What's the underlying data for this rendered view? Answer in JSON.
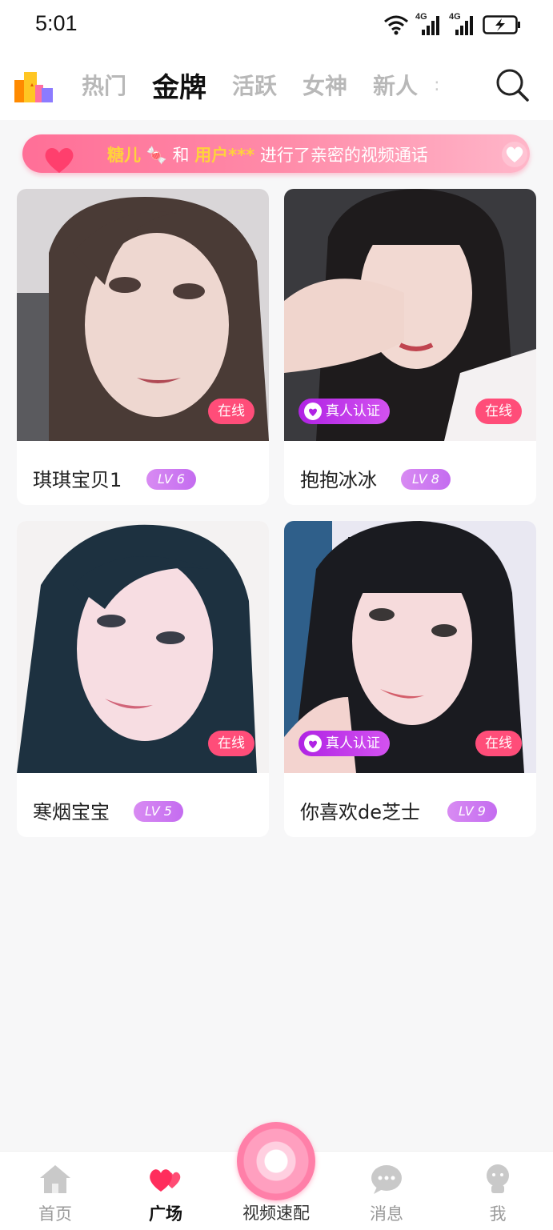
{
  "status_bar": {
    "time": "5:01",
    "signal1": "4G",
    "signal2": "4G"
  },
  "top_nav": {
    "tabs": [
      {
        "label": "热门"
      },
      {
        "label": "金牌"
      },
      {
        "label": "活跃"
      },
      {
        "label": "女神"
      },
      {
        "label": "新人"
      }
    ],
    "more": ":"
  },
  "banner": {
    "user1": "糖儿",
    "connector": "和",
    "user2": "用户***",
    "message": "进行了亲密的视频通话"
  },
  "cards": [
    {
      "name": "琪琪宝贝1",
      "level": "LV 6",
      "online": "在线",
      "verified": ""
    },
    {
      "name": "抱抱冰冰",
      "level": "LV 8",
      "online": "在线",
      "verified": "真人认证"
    },
    {
      "name": "寒烟宝宝",
      "level": "LV 5",
      "online": "在线",
      "verified": ""
    },
    {
      "name": "你喜欢de芝士",
      "level": "LV 9",
      "online": "在线",
      "verified": "真人认证"
    }
  ],
  "bottom_nav": {
    "home": "首页",
    "square": "广场",
    "match": "视频速配",
    "messages": "消息",
    "me": "我"
  },
  "colors": {
    "accent": "#ff4d79",
    "banner_highlight": "#ffd23c",
    "verified": "#b023e4",
    "level": "#c46cf0"
  }
}
